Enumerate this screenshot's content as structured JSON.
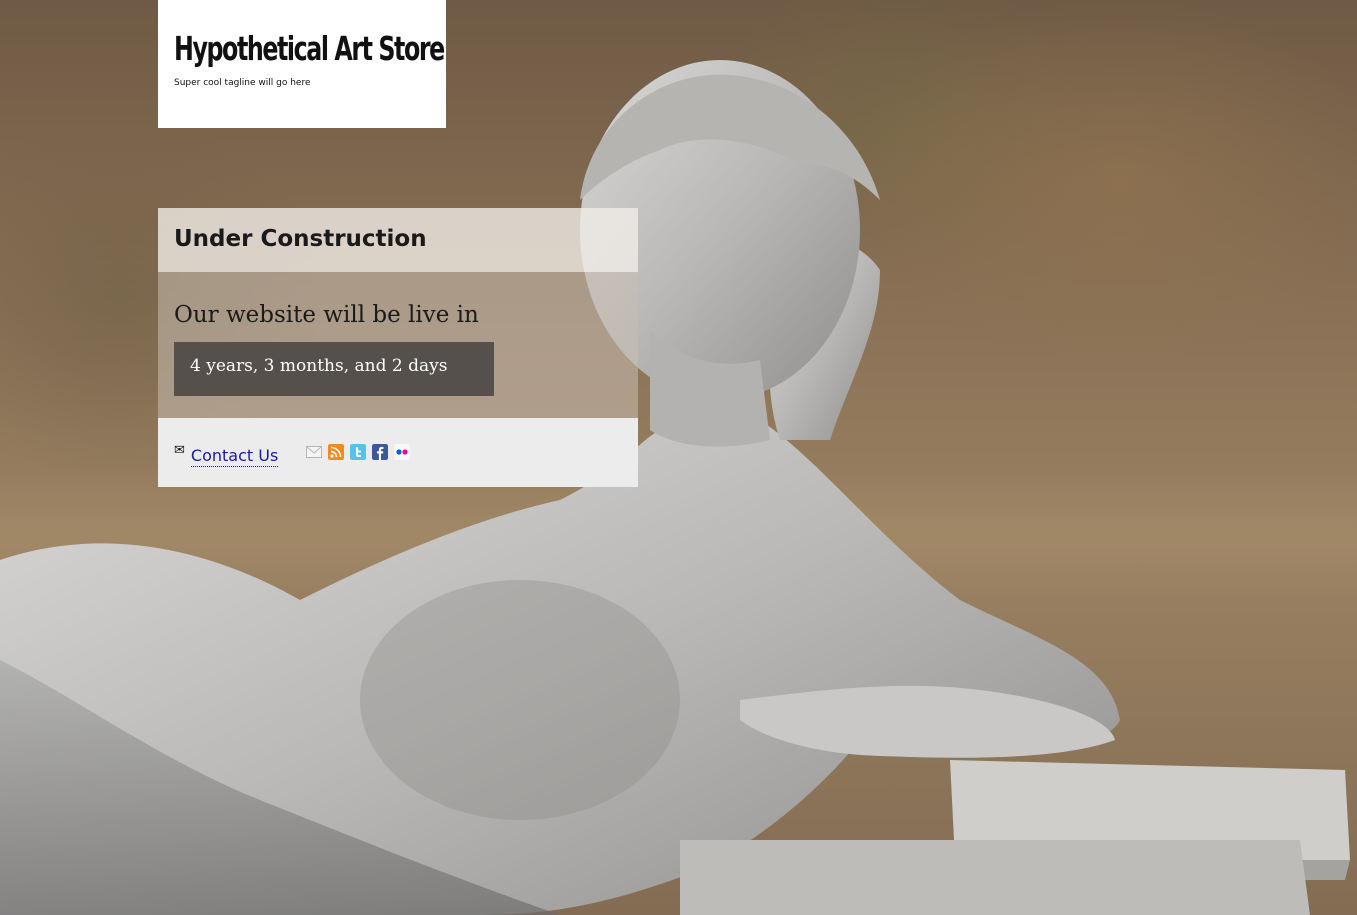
{
  "logo": {
    "title": "Hypothetical Art Store",
    "tagline": "Super cool tagline will go here"
  },
  "panel": {
    "heading": "Under Construction",
    "live_text": "Our website will be live in",
    "countdown": "4 years, 3 months, and 2 days"
  },
  "footer": {
    "contact_label": "Contact Us",
    "social_icons": [
      "email-icon",
      "rss-icon",
      "twitter-icon",
      "facebook-icon",
      "flickr-icon"
    ]
  },
  "colors": {
    "countdown_bg": "#55504c",
    "link": "#1a1aa6",
    "rss": "#f28b1e",
    "twitter": "#55c2ea",
    "facebook": "#3b5998",
    "flickr_pink": "#ff0084",
    "flickr_blue": "#0063dc"
  }
}
